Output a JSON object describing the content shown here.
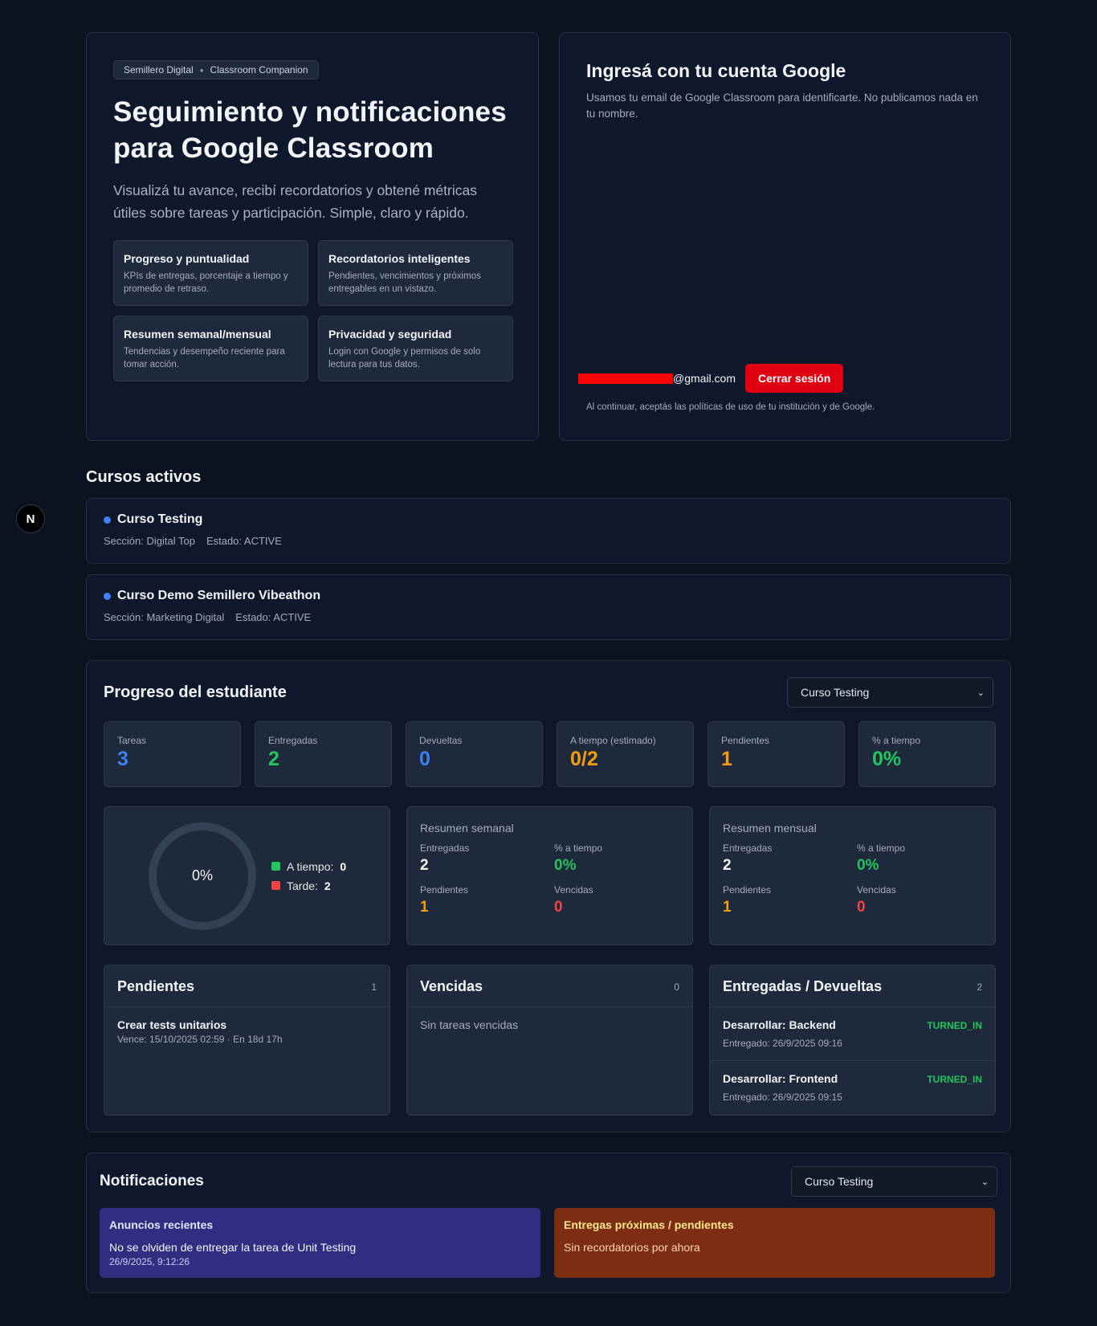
{
  "hero": {
    "crumb_a": "Semillero Digital",
    "crumb_b": "Classroom Companion",
    "title": "Seguimiento y notificaciones para Google Classroom",
    "lead": "Visualizá tu avance, recibí recordatorios y obtené métricas útiles sobre tareas y participación. Simple, claro y rápido.",
    "features": [
      {
        "title": "Progreso y puntualidad",
        "desc": "KPIs de entregas, porcentaje a tiempo y promedio de retraso."
      },
      {
        "title": "Recordatorios inteligentes",
        "desc": "Pendientes, vencimientos y próximos entregables en un vistazo."
      },
      {
        "title": "Resumen semanal/mensual",
        "desc": "Tendencias y desempeño reciente para tomar acción."
      },
      {
        "title": "Privacidad y seguridad",
        "desc": "Login con Google y permisos de solo lectura para tus datos."
      }
    ]
  },
  "login": {
    "title": "Ingresá con tu cuenta Google",
    "subtitle": "Usamos tu email de Google Classroom para identificarte. No publicamos nada en tu nombre.",
    "email_suffix": "@gmail.com",
    "logout_label": "Cerrar sesión",
    "terms": "Al continuar, aceptás las políticas de uso de tu institución y de Google."
  },
  "courses": {
    "title": "Cursos activos",
    "items": [
      {
        "name": "Curso Testing",
        "section": "Sección: Digital Top",
        "state": "Estado: ACTIVE"
      },
      {
        "name": "Curso Demo Semillero Vibeathon",
        "section": "Sección: Marketing Digital",
        "state": "Estado: ACTIVE"
      }
    ]
  },
  "progress": {
    "title": "Progreso del estudiante",
    "selected_course": "Curso Testing",
    "kpis": [
      {
        "label": "Tareas",
        "value": "3",
        "color": "#3b82f6"
      },
      {
        "label": "Entregadas",
        "value": "2",
        "color": "#22c55e"
      },
      {
        "label": "Devueltas",
        "value": "0",
        "color": "#3b82f6"
      },
      {
        "label": "A tiempo (estimado)",
        "value": "0/2",
        "color": "#f59e0b"
      },
      {
        "label": "Pendientes",
        "value": "1",
        "color": "#f59e0b"
      },
      {
        "label": "% a tiempo",
        "value": "0%",
        "color": "#22c55e"
      }
    ],
    "donut": {
      "center_label": "0%",
      "on_time_fraction": 0,
      "legend": [
        {
          "label": "A tiempo:",
          "value": "0",
          "color": "#22c55e"
        },
        {
          "label": "Tarde:",
          "value": "2",
          "color": "#ef4444"
        }
      ]
    },
    "weekly": {
      "title": "Resumen semanal",
      "entregadas_label": "Entregadas",
      "entregadas": "2",
      "ontime_label": "% a tiempo",
      "ontime": "0%",
      "pendientes_label": "Pendientes",
      "pendientes": "1",
      "vencidas_label": "Vencidas",
      "vencidas": "0"
    },
    "monthly": {
      "title": "Resumen mensual",
      "entregadas_label": "Entregadas",
      "entregadas": "2",
      "ontime_label": "% a tiempo",
      "ontime": "0%",
      "pendientes_label": "Pendientes",
      "pendientes": "1",
      "vencidas_label": "Vencidas",
      "vencidas": "0"
    },
    "pending": {
      "title": "Pendientes",
      "count": "1",
      "items": [
        {
          "title": "Crear tests unitarios",
          "sub": "Vence: 15/10/2025 02:59 · En 18d 17h"
        }
      ]
    },
    "overdue": {
      "title": "Vencidas",
      "count": "0",
      "empty": "Sin tareas vencidas"
    },
    "submitted": {
      "title": "Entregadas / Devueltas",
      "count": "2",
      "items": [
        {
          "title": "Desarrollar: Backend",
          "sub": "Entregado: 26/9/2025 09:16",
          "status": "TURNED_IN"
        },
        {
          "title": "Desarrollar: Frontend",
          "sub": "Entregado: 26/9/2025 09:15",
          "status": "TURNED_IN"
        }
      ]
    }
  },
  "notifications": {
    "title": "Notificaciones",
    "selected_course": "Curso Testing",
    "announcements": {
      "title": "Anuncios recientes",
      "message": "No se olviden de entregar la tarea de Unit Testing",
      "date": "26/9/2025, 9:12:26"
    },
    "due": {
      "title": "Entregas próximas / pendientes",
      "message": "Sin recordatorios por ahora"
    }
  },
  "badge": {
    "letter": "N"
  },
  "icons": {
    "select": "chevron-down-icon",
    "course_bullet": "dot-icon"
  }
}
